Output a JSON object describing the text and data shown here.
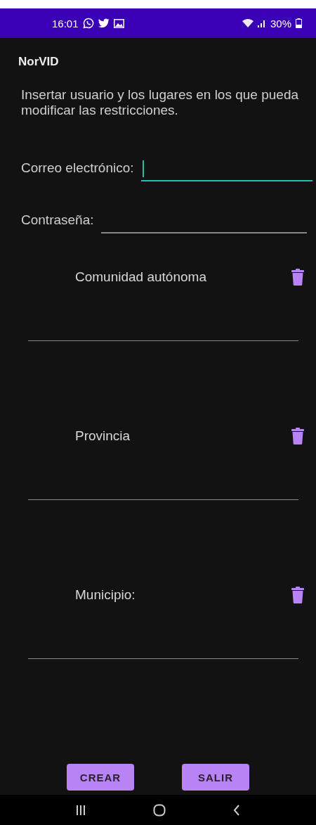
{
  "status_bar": {
    "time": "16:01",
    "battery": "30%"
  },
  "app_bar": {
    "title": "NorVID"
  },
  "instructions": "Insertar usuario y los lugares en los que pueda modificar las restricciones.",
  "fields": [
    {
      "label": "Correo electrónico:",
      "focused": true
    },
    {
      "label": "Contraseña:",
      "focused": false
    }
  ],
  "places": [
    {
      "label": "Comunidad autónoma"
    },
    {
      "label": "Provincia"
    },
    {
      "label": "Municipio:"
    }
  ],
  "buttons": [
    "CREAR",
    "SALIR"
  ]
}
